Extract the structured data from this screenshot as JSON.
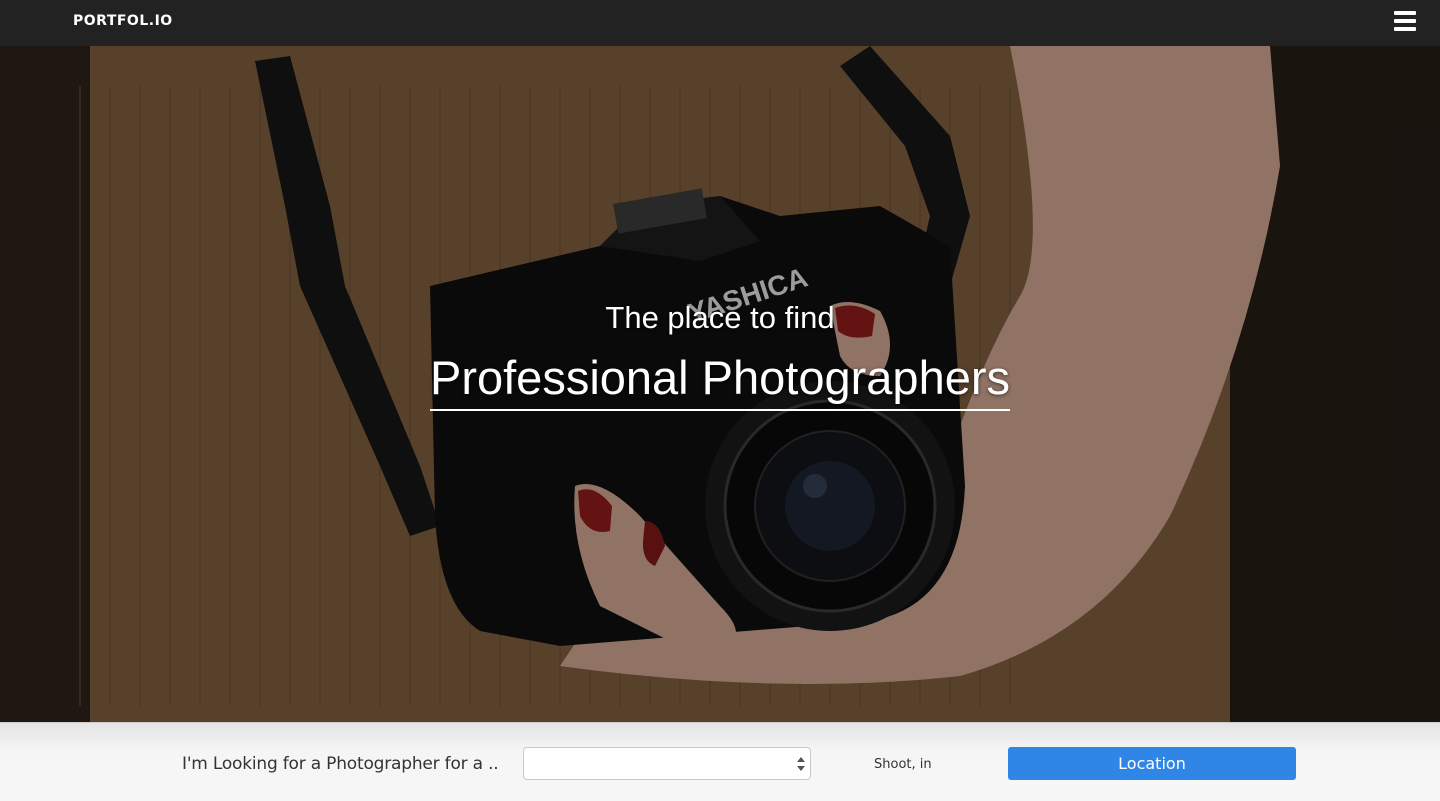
{
  "navbar": {
    "logo": "PORTFOL.IO",
    "menu_icon": "hamburger-menu-icon"
  },
  "hero": {
    "subtitle": "The place to find",
    "title": "Professional Photographers",
    "image_description": "camera-photo"
  },
  "search": {
    "label": "I'm Looking for a Photographer for a ..",
    "select_value": "",
    "shoot_label": "Shoot, in",
    "location_button": "Location"
  },
  "colors": {
    "navbar_bg": "#222222",
    "button_accent": "#2f86e6"
  }
}
